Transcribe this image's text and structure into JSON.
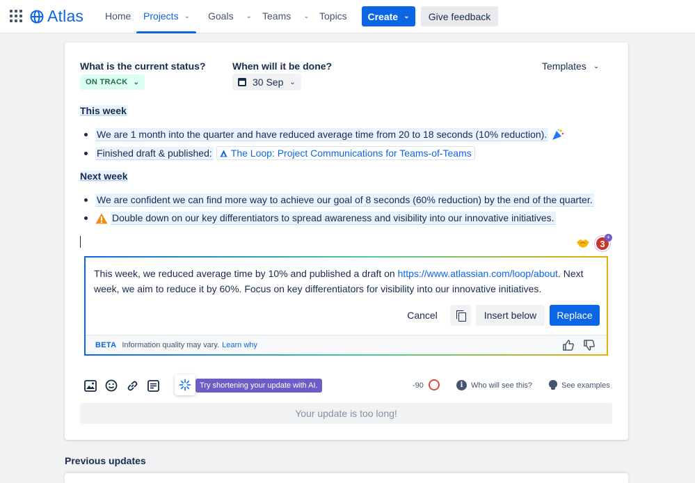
{
  "nav": {
    "logo": "Atlas",
    "items": [
      {
        "label": "Home"
      },
      {
        "label": "Projects"
      },
      {
        "label": "Goals"
      },
      {
        "label": "Teams"
      },
      {
        "label": "Topics"
      }
    ],
    "create_label": "Create",
    "feedback_label": "Give feedback",
    "accent": "#0c66e4"
  },
  "form": {
    "status_question": "What is the current status?",
    "status_value": "ON TRACK",
    "date_question": "When will it be done?",
    "date_value": "30 Sep",
    "templates_label": "Templates"
  },
  "content": {
    "this_week_heading": "This week",
    "this_week": [
      "We are 1 month into the quarter and have reduced average time from 20 to 18 seconds (10% reduction).",
      "Finished draft & published:"
    ],
    "loop_link": "The Loop: Project Communications for Teams-of-Teams",
    "next_week_heading": "Next week",
    "next_week": [
      "We are confident we can find more way to achieve our goal of 8 seconds (60% reduction) by the end of the quarter.",
      "Double down on our key differentiators to spread awareness and visibility into our innovative initiatives."
    ],
    "ai_badge_count": "3"
  },
  "ai_panel": {
    "text_before": "This week, we reduced average time by 10% and published a draft on ",
    "link": "https://www.atlassian.com/loop/about",
    "text_after": ". Next week, we aim to reduce it by 60%. Focus on key differentiators for visibility into our innovative initiatives.",
    "cancel_label": "Cancel",
    "insert_label": "Insert below",
    "replace_label": "Replace",
    "beta_label": "BETA",
    "quality_note": "Information quality may vary.",
    "learn_label": "Learn why"
  },
  "toolbar": {
    "ai_tip": "Try shortening your update with AI.",
    "char_count": "-90",
    "who_label": "Who will see this?",
    "examples_label": "See examples",
    "too_long": "Your update is too long!"
  },
  "previous": {
    "title": "Previous updates"
  }
}
